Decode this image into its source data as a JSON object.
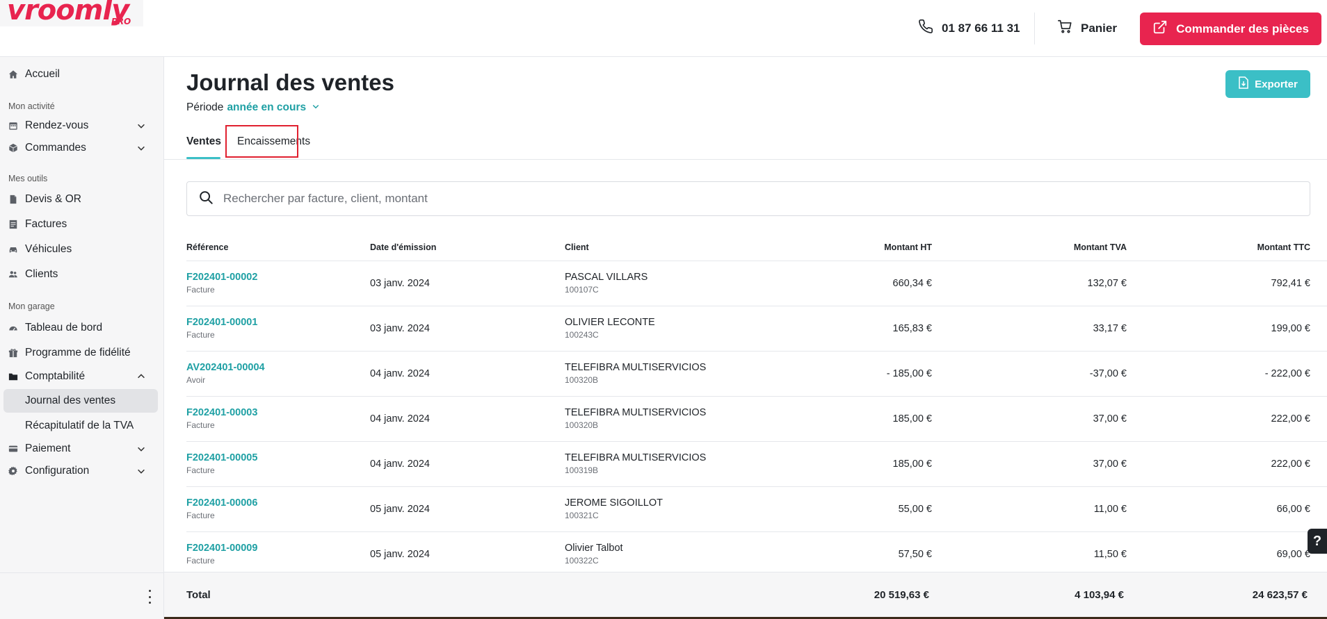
{
  "brand": {
    "logo_text": "vroomly",
    "logo_suffix": "PRO",
    "color": "#e8244f"
  },
  "header": {
    "phone": "01 87 66 11 31",
    "cart_label": "Panier",
    "order_button": "Commander des pièces"
  },
  "sidebar": {
    "home": "Accueil",
    "section_activity": "Mon activité",
    "rendezvous": "Rendez-vous",
    "commandes": "Commandes",
    "section_tools": "Mes outils",
    "devis": "Devis & OR",
    "factures": "Factures",
    "vehicules": "Véhicules",
    "clients": "Clients",
    "section_garage": "Mon garage",
    "tableau": "Tableau de bord",
    "fidelite": "Programme de fidélité",
    "comptabilite": "Comptabilité",
    "journal": "Journal des ventes",
    "recap_tva": "Récapitulatif de la TVA",
    "paiement": "Paiement",
    "configuration": "Configuration"
  },
  "page": {
    "title": "Journal des ventes",
    "period_label": "Période",
    "period_value": "année en cours",
    "export_button": "Exporter",
    "tabs": {
      "ventes": "Ventes",
      "encaissements": "Encaissements"
    },
    "search_placeholder": "Rechercher par facture, client, montant"
  },
  "table": {
    "headers": {
      "reference": "Référence",
      "date": "Date d'émission",
      "client": "Client",
      "ht": "Montant HT",
      "tva": "Montant TVA",
      "ttc": "Montant TTC"
    },
    "rows": [
      {
        "ref": "F202401-00002",
        "type": "Facture",
        "date": "03 janv. 2024",
        "client": "PASCAL VILLARS",
        "code": "100107C",
        "ht": "660,34 €",
        "tva": "132,07 €",
        "ttc": "792,41 €"
      },
      {
        "ref": "F202401-00001",
        "type": "Facture",
        "date": "03 janv. 2024",
        "client": "OLIVIER LECONTE",
        "code": "100243C",
        "ht": "165,83 €",
        "tva": "33,17 €",
        "ttc": "199,00 €"
      },
      {
        "ref": "AV202401-00004",
        "type": "Avoir",
        "date": "04 janv. 2024",
        "client": "TELEFIBRA MULTISERVICIOS",
        "code": "100320B",
        "ht": "- 185,00 €",
        "tva": "-37,00 €",
        "ttc": "- 222,00 €"
      },
      {
        "ref": "F202401-00003",
        "type": "Facture",
        "date": "04 janv. 2024",
        "client": "TELEFIBRA MULTISERVICIOS",
        "code": "100320B",
        "ht": "185,00 €",
        "tva": "37,00 €",
        "ttc": "222,00 €"
      },
      {
        "ref": "F202401-00005",
        "type": "Facture",
        "date": "04 janv. 2024",
        "client": "TELEFIBRA MULTISERVICIOS",
        "code": "100319B",
        "ht": "185,00 €",
        "tva": "37,00 €",
        "ttc": "222,00 €"
      },
      {
        "ref": "F202401-00006",
        "type": "Facture",
        "date": "05 janv. 2024",
        "client": "JEROME SIGOILLOT",
        "code": "100321C",
        "ht": "55,00 €",
        "tva": "11,00 €",
        "ttc": "66,00 €"
      },
      {
        "ref": "F202401-00009",
        "type": "Facture",
        "date": "05 janv. 2024",
        "client": "Olivier Talbot",
        "code": "100322C",
        "ht": "57,50 €",
        "tva": "11,50 €",
        "ttc": "69,00 €"
      }
    ],
    "total": {
      "label": "Total",
      "ht": "20 519,63 €",
      "tva": "4 103,94 €",
      "ttc": "24 623,57 €"
    }
  },
  "help_label": "?"
}
